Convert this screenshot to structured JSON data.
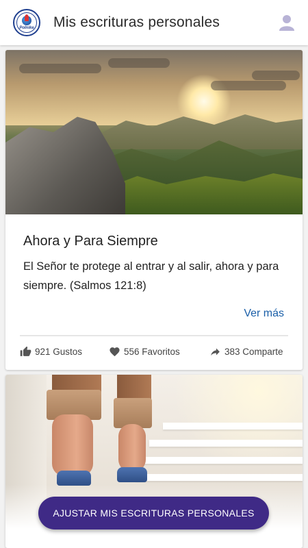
{
  "appbar": {
    "title": "Mis escrituras personales",
    "logo_text": "Polnike",
    "logo_icon": "church-logo",
    "avatar_icon": "user-avatar-icon"
  },
  "cards": [
    {
      "image": "mountain-sunrise-photo",
      "title": "Ahora y Para Siempre",
      "body": "El Señor te protege al entrar y al salir, ahora y para siempre. (Salmos 121:8)",
      "more_label": "Ver más",
      "likes": "921 Gustos",
      "favorites": "556 Favoritos",
      "shares": "383 Comparte"
    },
    {
      "image": "walking-up-stairs-photo"
    }
  ],
  "fab": {
    "label": "AJUSTAR MIS ESCRITURAS PERSONALES"
  },
  "colors": {
    "accent": "#3f2a86",
    "link": "#1a5fa8",
    "icon_gray": "#555555"
  }
}
